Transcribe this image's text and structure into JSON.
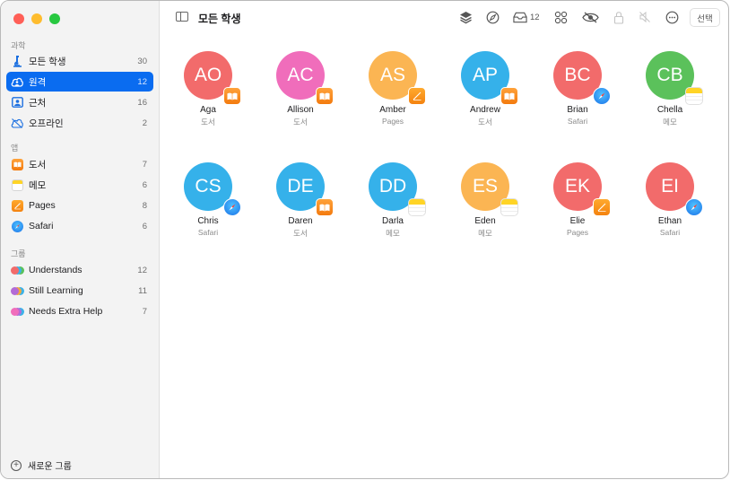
{
  "window": {
    "traffic_lights": [
      "close",
      "minimize",
      "zoom"
    ]
  },
  "sidebar": {
    "sections": [
      {
        "label": "과학",
        "items": [
          {
            "label": "모든 학생",
            "count": "30",
            "icon": "microscope-icon",
            "selected": false
          },
          {
            "label": "원격",
            "count": "12",
            "icon": "cloud-person-icon",
            "selected": true
          },
          {
            "label": "근처",
            "count": "16",
            "icon": "person-frame-icon",
            "selected": false
          },
          {
            "label": "오프라인",
            "count": "2",
            "icon": "cloud-offline-icon",
            "selected": false
          }
        ]
      },
      {
        "label": "앱",
        "items": [
          {
            "label": "도서",
            "count": "7",
            "icon": "books-app-icon"
          },
          {
            "label": "메모",
            "count": "6",
            "icon": "notes-app-icon"
          },
          {
            "label": "Pages",
            "count": "8",
            "icon": "pages-app-icon"
          },
          {
            "label": "Safari",
            "count": "6",
            "icon": "safari-app-icon"
          }
        ]
      },
      {
        "label": "그룹",
        "items": [
          {
            "label": "Understands",
            "count": "12",
            "icon": "group-icon",
            "colors": [
              "#f26b6b",
              "#3cb2e8",
              "#5bc15b"
            ]
          },
          {
            "label": "Still Learning",
            "count": "11",
            "icon": "group-icon",
            "colors": [
              "#b36bd6",
              "#f3a93c",
              "#3cb2e8"
            ]
          },
          {
            "label": "Needs Extra Help",
            "count": "7",
            "icon": "group-icon",
            "colors": [
              "#f06dbb",
              "#b36bd6",
              "#3cb2e8"
            ]
          }
        ]
      }
    ],
    "new_group_label": "새로운 그룹"
  },
  "toolbar": {
    "title": "모든 학생",
    "inbox_count": "12",
    "select_label": "선택",
    "icons": [
      "layers-icon",
      "compass-icon",
      "inbox-icon",
      "grid-icon",
      "eye-slash-icon",
      "lock-icon",
      "mute-icon",
      "more-icon"
    ]
  },
  "students": [
    {
      "initials": "AO",
      "name": "Aga",
      "app": "도서",
      "app_type": "books",
      "color": "#f26b6b"
    },
    {
      "initials": "AC",
      "name": "Allison",
      "app": "도서",
      "app_type": "books",
      "color": "#f06dbb"
    },
    {
      "initials": "AS",
      "name": "Amber",
      "app": "Pages",
      "app_type": "pages",
      "color": "#fbb553"
    },
    {
      "initials": "AP",
      "name": "Andrew",
      "app": "도서",
      "app_type": "books",
      "color": "#35b1ea"
    },
    {
      "initials": "BC",
      "name": "Brian",
      "app": "Safari",
      "app_type": "safari",
      "color": "#f26b6b"
    },
    {
      "initials": "CB",
      "name": "Chella",
      "app": "메모",
      "app_type": "notes",
      "color": "#5bc15b"
    },
    {
      "initials": "CS",
      "name": "Chris",
      "app": "Safari",
      "app_type": "safari",
      "color": "#35b1ea"
    },
    {
      "initials": "DE",
      "name": "Daren",
      "app": "도서",
      "app_type": "books",
      "color": "#35b1ea"
    },
    {
      "initials": "DD",
      "name": "Darla",
      "app": "메모",
      "app_type": "notes",
      "color": "#35b1ea"
    },
    {
      "initials": "ES",
      "name": "Eden",
      "app": "메모",
      "app_type": "notes",
      "color": "#fbb553"
    },
    {
      "initials": "EK",
      "name": "Elie",
      "app": "Pages",
      "app_type": "pages",
      "color": "#f26b6b"
    },
    {
      "initials": "EI",
      "name": "Ethan",
      "app": "Safari",
      "app_type": "safari",
      "color": "#f26b6b"
    }
  ]
}
